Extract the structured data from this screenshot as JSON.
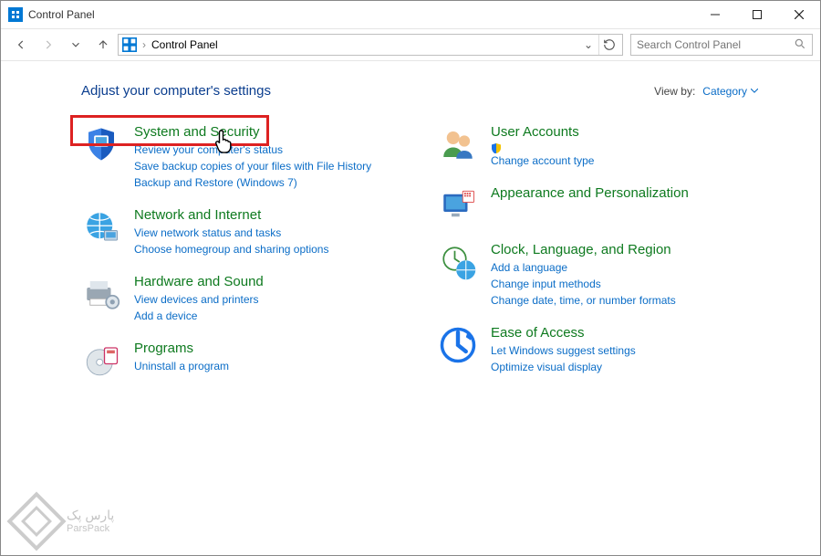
{
  "window": {
    "title": "Control Panel"
  },
  "addr": {
    "location": "Control Panel"
  },
  "search": {
    "placeholder": "Search Control Panel"
  },
  "head": {
    "title": "Adjust your computer's settings",
    "viewby_label": "View by:",
    "viewby_value": "Category"
  },
  "left": [
    {
      "title": "System and Security",
      "links": [
        "Review your computer's status",
        "Save backup copies of your files with File History",
        "Backup and Restore (Windows 7)"
      ],
      "highlight": true
    },
    {
      "title": "Network and Internet",
      "links": [
        "View network status and tasks",
        "Choose homegroup and sharing options"
      ]
    },
    {
      "title": "Hardware and Sound",
      "links": [
        "View devices and printers",
        "Add a device"
      ]
    },
    {
      "title": "Programs",
      "links": [
        "Uninstall a program"
      ]
    }
  ],
  "right": [
    {
      "title": "User Accounts",
      "links": [
        "Change account type"
      ],
      "shield_on": [
        0
      ]
    },
    {
      "title": "Appearance and Personalization",
      "links": []
    },
    {
      "title": "Clock, Language, and Region",
      "links": [
        "Add a language",
        "Change input methods",
        "Change date, time, or number formats"
      ]
    },
    {
      "title": "Ease of Access",
      "links": [
        "Let Windows suggest settings",
        "Optimize visual display"
      ]
    }
  ],
  "watermark": {
    "fa": "پارس پک",
    "en": "ParsPack"
  }
}
